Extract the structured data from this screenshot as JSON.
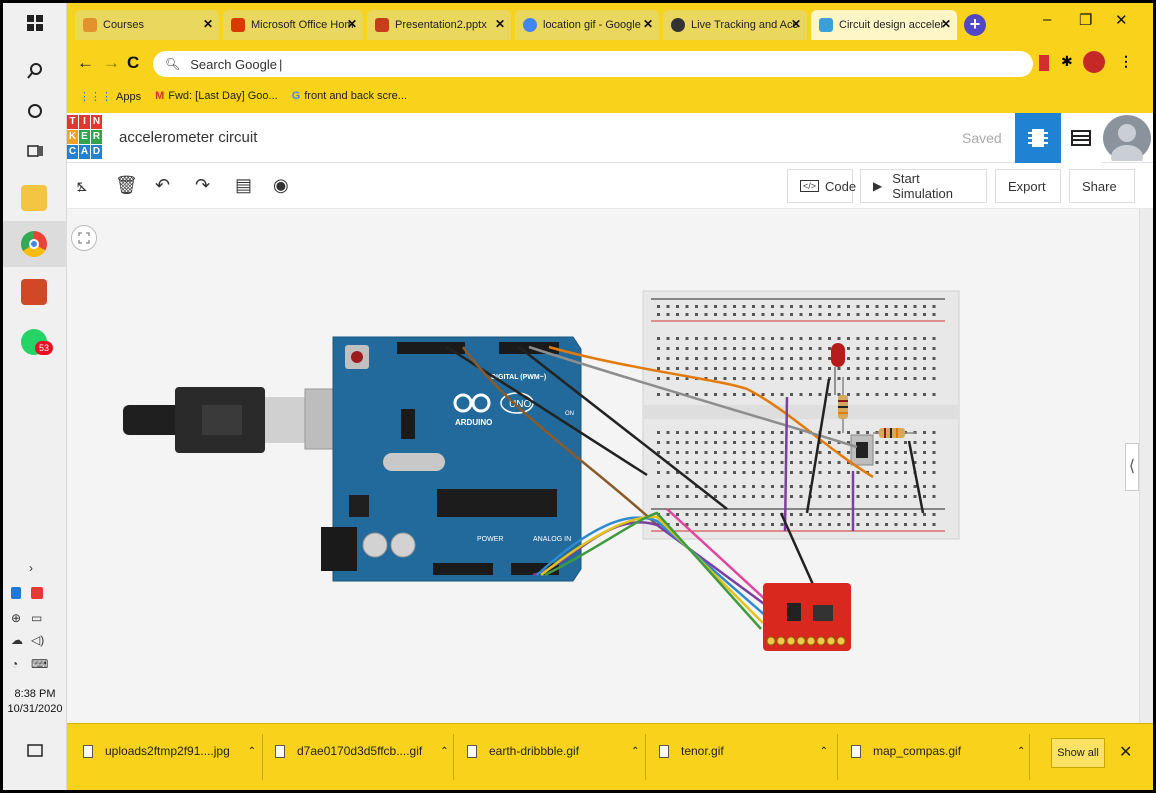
{
  "taskbar": {
    "icons": [
      "windows-icon",
      "search-icon",
      "cortana-icon",
      "task-view-icon",
      "file-explorer-icon",
      "chrome-icon",
      "powerpoint-icon",
      "whatsapp-icon"
    ],
    "whatsapp_badge": "53",
    "clock_time": "8:38 PM",
    "clock_date": "10/31/2020"
  },
  "browser": {
    "tabs": [
      {
        "title": "Courses",
        "color": "#e3912c"
      },
      {
        "title": "Microsoft Office Hom",
        "color": "#d83b01"
      },
      {
        "title": "Presentation2.pptx",
        "color": "#c43e1c"
      },
      {
        "title": "location gif - Google",
        "color": "#4285f4"
      },
      {
        "title": "Live Tracking and Acc",
        "color": "#333333"
      },
      {
        "title": "Circuit design acceler",
        "color": "#3ca0d8"
      }
    ],
    "omnibox_placeholder": "Search Google",
    "bookmarks": [
      "Apps",
      "Fwd: [Last Day] Goo...",
      "front and back scre..."
    ],
    "theme_color": "#f9d31b"
  },
  "tinkercad": {
    "logo_letters": [
      "T",
      "I",
      "N",
      "K",
      "E",
      "R",
      "C",
      "A",
      "D"
    ],
    "project_title": "accelerometer circuit",
    "saved_label": "Saved",
    "toolbar": {
      "code_label": "Code",
      "start_simulation_label": "Start Simulation",
      "export_label": "Export",
      "share_label": "Share"
    },
    "accent_color": "#1f82d2"
  },
  "circuit": {
    "arduino_brand": "ARDUINO",
    "arduino_model": "UNO",
    "digital_label": "DIGITAL (PWM~)",
    "power_label": "POWER",
    "analog_label": "ANALOG IN",
    "on_label": "ON"
  },
  "downloads": {
    "items": [
      "uploads2ftmp2f91....jpg",
      "d7ae0170d3d5ffcb....gif",
      "earth-dribbble.gif",
      "tenor.gif",
      "map_compas.gif"
    ],
    "show_all_label": "Show all"
  }
}
